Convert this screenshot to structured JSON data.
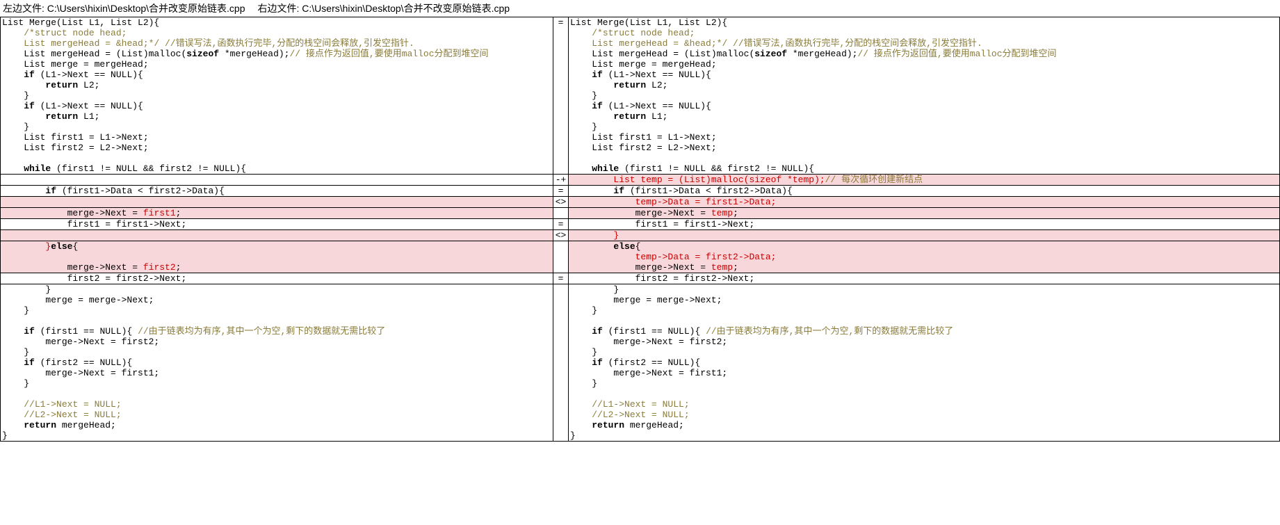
{
  "header": {
    "left_label": "左边文件: C:\\Users\\hixin\\Desktop\\合并改变原始链表.cpp",
    "right_label": "右边文件: C:\\Users\\hixin\\Desktop\\合并不改变原始链表.cpp"
  },
  "rows": [
    {
      "l": [
        {
          "t": "List Merge(List L1, List L2){"
        }
      ],
      "g": "=",
      "r": [
        {
          "t": "List Merge(List L1, List L2){"
        }
      ]
    },
    {
      "l": [
        {
          "t": "    ",
          "c": ""
        },
        {
          "t": "/*struct node head;",
          "c": "cmt"
        }
      ],
      "g": "",
      "r": [
        {
          "t": "    "
        },
        {
          "t": "/*struct node head;",
          "c": "cmt"
        }
      ]
    },
    {
      "l": [
        {
          "t": "    "
        },
        {
          "t": "List mergeHead = &head;*/ //错误写法,函数执行完毕,分配的栈空间会释放,引发空指针.",
          "c": "cmt"
        }
      ],
      "g": "",
      "r": [
        {
          "t": "    "
        },
        {
          "t": "List mergeHead = &head;*/ //错误写法,函数执行完毕,分配的栈空间会释放,引发空指针.",
          "c": "cmt"
        }
      ]
    },
    {
      "l": [
        {
          "t": "    List mergeHead = (List)malloc("
        },
        {
          "t": "sizeof",
          "c": "kw"
        },
        {
          "t": " *mergeHead);"
        },
        {
          "t": "// 接点作为返回值,要使用malloc分配到堆空间",
          "c": "cmt"
        }
      ],
      "g": "",
      "r": [
        {
          "t": "    List mergeHead = (List)malloc("
        },
        {
          "t": "sizeof",
          "c": "kw"
        },
        {
          "t": " *mergeHead);"
        },
        {
          "t": "// 接点作为返回值,要使用malloc分配到堆空间",
          "c": "cmt"
        }
      ]
    },
    {
      "l": [
        {
          "t": "    List merge = mergeHead;"
        }
      ],
      "g": "",
      "r": [
        {
          "t": "    List merge = mergeHead;"
        }
      ]
    },
    {
      "l": [
        {
          "t": "    "
        },
        {
          "t": "if",
          "c": "kw"
        },
        {
          "t": " (L1->Next == NULL){"
        }
      ],
      "g": "",
      "r": [
        {
          "t": "    "
        },
        {
          "t": "if",
          "c": "kw"
        },
        {
          "t": " (L1->Next == NULL){"
        }
      ]
    },
    {
      "l": [
        {
          "t": "        "
        },
        {
          "t": "return",
          "c": "kw"
        },
        {
          "t": " L2;"
        }
      ],
      "g": "",
      "r": [
        {
          "t": "        "
        },
        {
          "t": "return",
          "c": "kw"
        },
        {
          "t": " L2;"
        }
      ]
    },
    {
      "l": [
        {
          "t": "    }"
        }
      ],
      "g": "",
      "r": [
        {
          "t": "    }"
        }
      ]
    },
    {
      "l": [
        {
          "t": "    "
        },
        {
          "t": "if",
          "c": "kw"
        },
        {
          "t": " (L1->Next == NULL){"
        }
      ],
      "g": "",
      "r": [
        {
          "t": "    "
        },
        {
          "t": "if",
          "c": "kw"
        },
        {
          "t": " (L1->Next == NULL){"
        }
      ]
    },
    {
      "l": [
        {
          "t": "        "
        },
        {
          "t": "return",
          "c": "kw"
        },
        {
          "t": " L1;"
        }
      ],
      "g": "",
      "r": [
        {
          "t": "        "
        },
        {
          "t": "return",
          "c": "kw"
        },
        {
          "t": " L1;"
        }
      ]
    },
    {
      "l": [
        {
          "t": "    }"
        }
      ],
      "g": "",
      "r": [
        {
          "t": "    }"
        }
      ]
    },
    {
      "l": [
        {
          "t": "    List first1 = L1->Next;"
        }
      ],
      "g": "",
      "r": [
        {
          "t": "    List first1 = L1->Next;"
        }
      ]
    },
    {
      "l": [
        {
          "t": "    List first2 = L2->Next;"
        }
      ],
      "g": "",
      "r": [
        {
          "t": "    List first2 = L2->Next;"
        }
      ]
    },
    {
      "l": [
        {
          "t": ""
        }
      ],
      "g": "",
      "r": [
        {
          "t": ""
        }
      ]
    },
    {
      "l": [
        {
          "t": "    "
        },
        {
          "t": "while",
          "c": "kw"
        },
        {
          "t": " (first1 != NULL && first2 != NULL){"
        }
      ],
      "g": "",
      "r": [
        {
          "t": "    "
        },
        {
          "t": "while",
          "c": "kw"
        },
        {
          "t": " (first1 != NULL && first2 != NULL){"
        }
      ]
    },
    {
      "sep": true,
      "l": [
        {
          "t": ""
        }
      ],
      "g": "-+",
      "r": [
        {
          "t": "        "
        },
        {
          "t": "List temp = (List)malloc(sizeof *temp);",
          "c": "red"
        },
        {
          "t": "// 每次循环创建新结点",
          "c": "cmt"
        }
      ],
      "rd": true
    },
    {
      "sep": true,
      "l": [
        {
          "t": "        "
        },
        {
          "t": "if",
          "c": "kw"
        },
        {
          "t": " (first1->Data < first2->Data){"
        }
      ],
      "g": "=",
      "r": [
        {
          "t": "        "
        },
        {
          "t": "if",
          "c": "kw"
        },
        {
          "t": " (first1->Data < first2->Data){"
        }
      ]
    },
    {
      "sep": true,
      "ld": true,
      "rd": true,
      "l": [
        {
          "t": ""
        }
      ],
      "g": "<>",
      "r": [
        {
          "t": "            "
        },
        {
          "t": "temp->Data = first1->Data;",
          "c": "red"
        }
      ]
    },
    {
      "ld": true,
      "rd": true,
      "l": [
        {
          "t": "            merge->Next = "
        },
        {
          "t": "first1",
          "c": "red"
        },
        {
          "t": ";"
        }
      ],
      "g": "",
      "r": [
        {
          "t": "            merge->Next = "
        },
        {
          "t": "temp",
          "c": "red"
        },
        {
          "t": ";"
        }
      ]
    },
    {
      "sep": true,
      "l": [
        {
          "t": "            first1 = first1->Next;"
        }
      ],
      "g": "=",
      "r": [
        {
          "t": "            first1 = first1->Next;"
        }
      ]
    },
    {
      "sep": true,
      "ld": true,
      "rd": true,
      "l": [
        {
          "t": ""
        }
      ],
      "g": "<>",
      "r": [
        {
          "t": "        "
        },
        {
          "t": "}",
          "c": "red"
        }
      ]
    },
    {
      "ld": true,
      "rd": true,
      "l": [
        {
          "t": "        "
        },
        {
          "t": "}",
          "c": "red"
        },
        {
          "t": "else",
          "c": "kw"
        },
        {
          "t": "{"
        }
      ],
      "g": "",
      "r": [
        {
          "t": "        "
        },
        {
          "t": "else",
          "c": "kw"
        },
        {
          "t": "{"
        }
      ]
    },
    {
      "ld": true,
      "rd": true,
      "l": [
        {
          "t": ""
        }
      ],
      "g": "",
      "r": [
        {
          "t": "            "
        },
        {
          "t": "temp->Data = first2->Data;",
          "c": "red"
        }
      ]
    },
    {
      "ld": true,
      "rd": true,
      "l": [
        {
          "t": "            merge->Next = "
        },
        {
          "t": "first2",
          "c": "red"
        },
        {
          "t": ";"
        }
      ],
      "g": "",
      "r": [
        {
          "t": "            merge->Next = "
        },
        {
          "t": "temp",
          "c": "red"
        },
        {
          "t": ";"
        }
      ]
    },
    {
      "sep": true,
      "l": [
        {
          "t": "            first2 = first2->Next;"
        }
      ],
      "g": "=",
      "r": [
        {
          "t": "            first2 = first2->Next;"
        }
      ]
    },
    {
      "l": [
        {
          "t": "        }"
        }
      ],
      "g": "",
      "r": [
        {
          "t": "        }"
        }
      ]
    },
    {
      "l": [
        {
          "t": "        merge = merge->Next;"
        }
      ],
      "g": "",
      "r": [
        {
          "t": "        merge = merge->Next;"
        }
      ]
    },
    {
      "l": [
        {
          "t": "    }"
        }
      ],
      "g": "",
      "r": [
        {
          "t": "    }"
        }
      ]
    },
    {
      "l": [
        {
          "t": ""
        }
      ],
      "g": "",
      "r": [
        {
          "t": ""
        }
      ]
    },
    {
      "l": [
        {
          "t": "    "
        },
        {
          "t": "if",
          "c": "kw"
        },
        {
          "t": " (first1 == NULL){ "
        },
        {
          "t": "//由于链表均为有序,其中一个为空,剩下的数据就无需比较了",
          "c": "cmt"
        }
      ],
      "g": "",
      "r": [
        {
          "t": "    "
        },
        {
          "t": "if",
          "c": "kw"
        },
        {
          "t": " (first1 == NULL){ "
        },
        {
          "t": "//由于链表均为有序,其中一个为空,剩下的数据就无需比较了",
          "c": "cmt"
        }
      ]
    },
    {
      "l": [
        {
          "t": "        merge->Next = first2;"
        }
      ],
      "g": "",
      "r": [
        {
          "t": "        merge->Next = first2;"
        }
      ]
    },
    {
      "l": [
        {
          "t": "    }"
        }
      ],
      "g": "",
      "r": [
        {
          "t": "    }"
        }
      ]
    },
    {
      "l": [
        {
          "t": "    "
        },
        {
          "t": "if",
          "c": "kw"
        },
        {
          "t": " (first2 == NULL){"
        }
      ],
      "g": "",
      "r": [
        {
          "t": "    "
        },
        {
          "t": "if",
          "c": "kw"
        },
        {
          "t": " (first2 == NULL){"
        }
      ]
    },
    {
      "l": [
        {
          "t": "        merge->Next = first1;"
        }
      ],
      "g": "",
      "r": [
        {
          "t": "        merge->Next = first1;"
        }
      ]
    },
    {
      "l": [
        {
          "t": "    }"
        }
      ],
      "g": "",
      "r": [
        {
          "t": "    }"
        }
      ]
    },
    {
      "l": [
        {
          "t": ""
        }
      ],
      "g": "",
      "r": [
        {
          "t": ""
        }
      ]
    },
    {
      "l": [
        {
          "t": "    "
        },
        {
          "t": "//L1->Next = NULL;",
          "c": "cmt"
        }
      ],
      "g": "",
      "r": [
        {
          "t": "    "
        },
        {
          "t": "//L1->Next = NULL;",
          "c": "cmt"
        }
      ]
    },
    {
      "l": [
        {
          "t": "    "
        },
        {
          "t": "//L2->Next = NULL;",
          "c": "cmt"
        }
      ],
      "g": "",
      "r": [
        {
          "t": "    "
        },
        {
          "t": "//L2->Next = NULL;",
          "c": "cmt"
        }
      ]
    },
    {
      "l": [
        {
          "t": "    "
        },
        {
          "t": "return",
          "c": "kw"
        },
        {
          "t": " mergeHead;"
        }
      ],
      "g": "",
      "r": [
        {
          "t": "    "
        },
        {
          "t": "return",
          "c": "kw"
        },
        {
          "t": " mergeHead;"
        }
      ]
    },
    {
      "l": [
        {
          "t": "}"
        }
      ],
      "g": "",
      "r": [
        {
          "t": "}"
        }
      ]
    }
  ]
}
